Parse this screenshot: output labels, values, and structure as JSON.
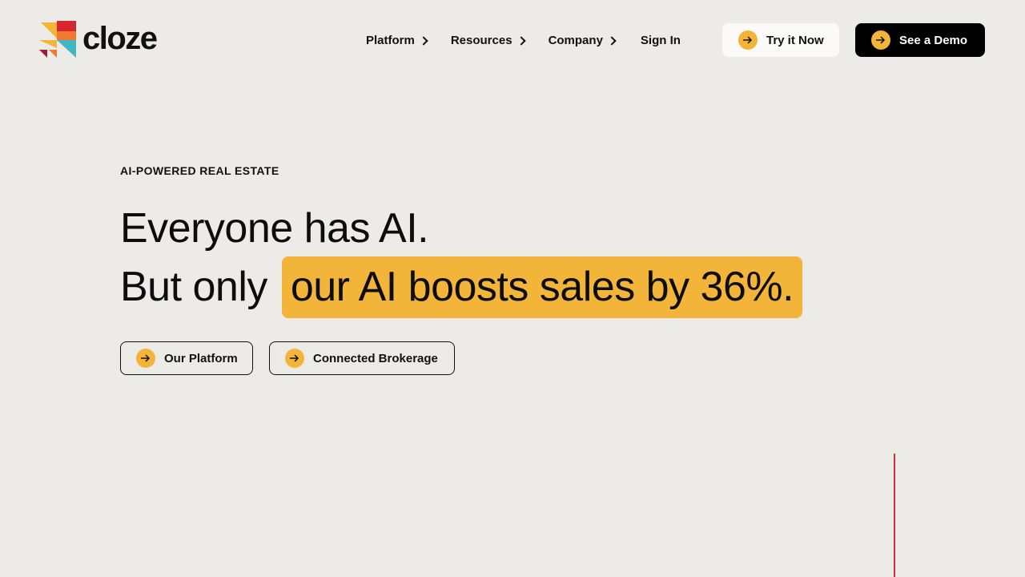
{
  "header": {
    "logo_text": "cloze",
    "nav": [
      {
        "label": "Platform",
        "has_chevron": true
      },
      {
        "label": "Resources",
        "has_chevron": true
      },
      {
        "label": "Company",
        "has_chevron": true
      },
      {
        "label": "Sign In",
        "has_chevron": false
      }
    ],
    "try_button": "Try it Now",
    "demo_button": "See a Demo"
  },
  "hero": {
    "eyebrow": "AI-POWERED REAL ESTATE",
    "headline_line1": "Everyone has AI.",
    "headline_line2_prefix": "But only",
    "headline_line2_highlight": "our AI boosts sales by 36%.",
    "buttons": [
      {
        "label": "Our Platform"
      },
      {
        "label": "Connected Brokerage"
      }
    ]
  },
  "icons": {
    "arrow": "arrow-right-icon",
    "chevron": "chevron-right-icon"
  },
  "colors": {
    "background": "#ecebe7",
    "accent": "#f3b43a",
    "dark": "#000000",
    "red": "#c8313a",
    "teal": "#3fb8c4",
    "orange": "#ef7a30"
  }
}
